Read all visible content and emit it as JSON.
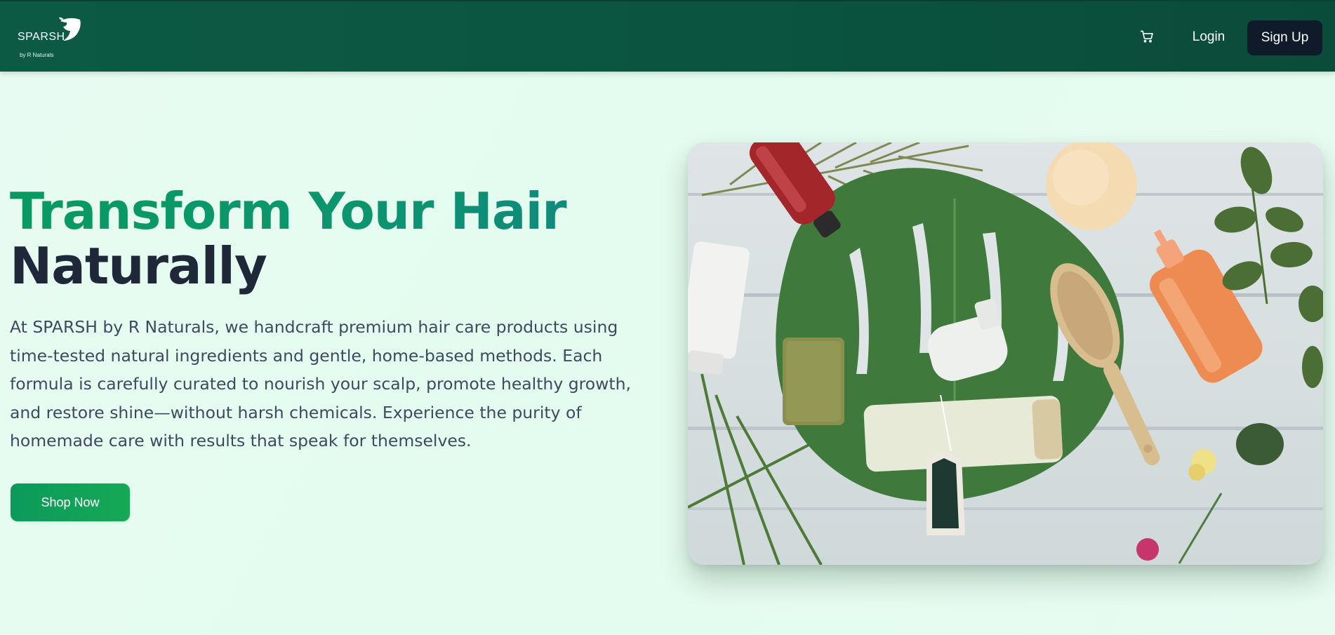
{
  "header": {
    "logo_text": "SPARSH",
    "logo_sub": "by R Naturals",
    "cart_icon": "cart-icon",
    "login_label": "Login",
    "signup_label": "Sign Up"
  },
  "hero": {
    "title_line1": "Transform Your Hair",
    "title_line2": "Naturally",
    "description": "At SPARSH by R Naturals, we handcraft premium hair care products using time-tested natural ingredients and gentle, home-based methods. Each formula is carefully curated to nourish your scalp, promote healthy growth, and restore shine—without harsh chemicals. Experience the purity of homemade care with results that speak for themselves.",
    "cta_label": "Shop Now"
  },
  "colors": {
    "header_bg": "#0b5540",
    "signup_bg": "#0f1b2b",
    "cta_bg": "#0b9a5c",
    "title_green": "#089a62",
    "title_dark": "#1e2838",
    "page_bg": "#e6fbf0"
  }
}
